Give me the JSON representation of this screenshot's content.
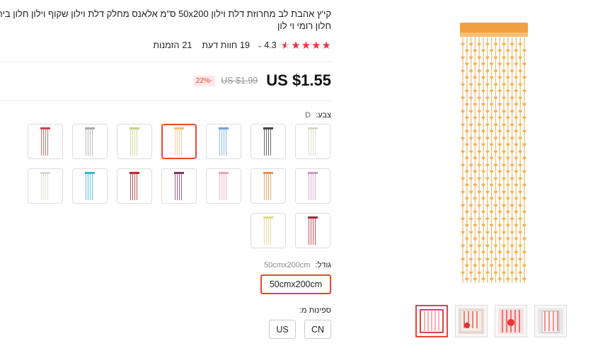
{
  "product": {
    "title": "קי'ץ אהבת לב מחרוזת דלת וילון 50x200 ס\"מ אלאנס מחלק דלת וילון שקוף וילון חלון בית חלון רומי וי לון",
    "rating": "4.3",
    "rating_caret": "⌄",
    "reviews_count": "19",
    "reviews_label": "חוות דעת",
    "orders_count": "21",
    "orders_label": "הזמנות"
  },
  "price": {
    "current": "US $1.55",
    "original": "US $1.99",
    "discount": "-22%"
  },
  "color": {
    "label": "צבע:",
    "selected": "D",
    "swatches": [
      {
        "hex": "#d9d6c8"
      },
      {
        "hex": "#444444"
      },
      {
        "hex": "#6fa5d8"
      },
      {
        "hex": "#f3c27a"
      },
      {
        "hex": "#c8d08c"
      },
      {
        "hex": "#aaaaaa"
      },
      {
        "hex": "#d94050"
      },
      {
        "hex": "#c99cc0"
      },
      {
        "hex": "#e8934a"
      },
      {
        "hex": "#e9a4b2"
      },
      {
        "hex": "#7a3b6b"
      },
      {
        "hex": "#b5292f"
      },
      {
        "hex": "#38b7d6"
      },
      {
        "hex": "#d8d8c4"
      },
      {
        "hex": "#a72830"
      },
      {
        "hex": "#e6d68a"
      }
    ]
  },
  "size": {
    "label": "גודל:",
    "selected": "50cmx200cm",
    "option": "50cmx200cm"
  },
  "shipping": {
    "label": "ספינות מ:",
    "options": [
      "CN",
      "US"
    ]
  },
  "gallery": {
    "thumb_count": 4
  }
}
